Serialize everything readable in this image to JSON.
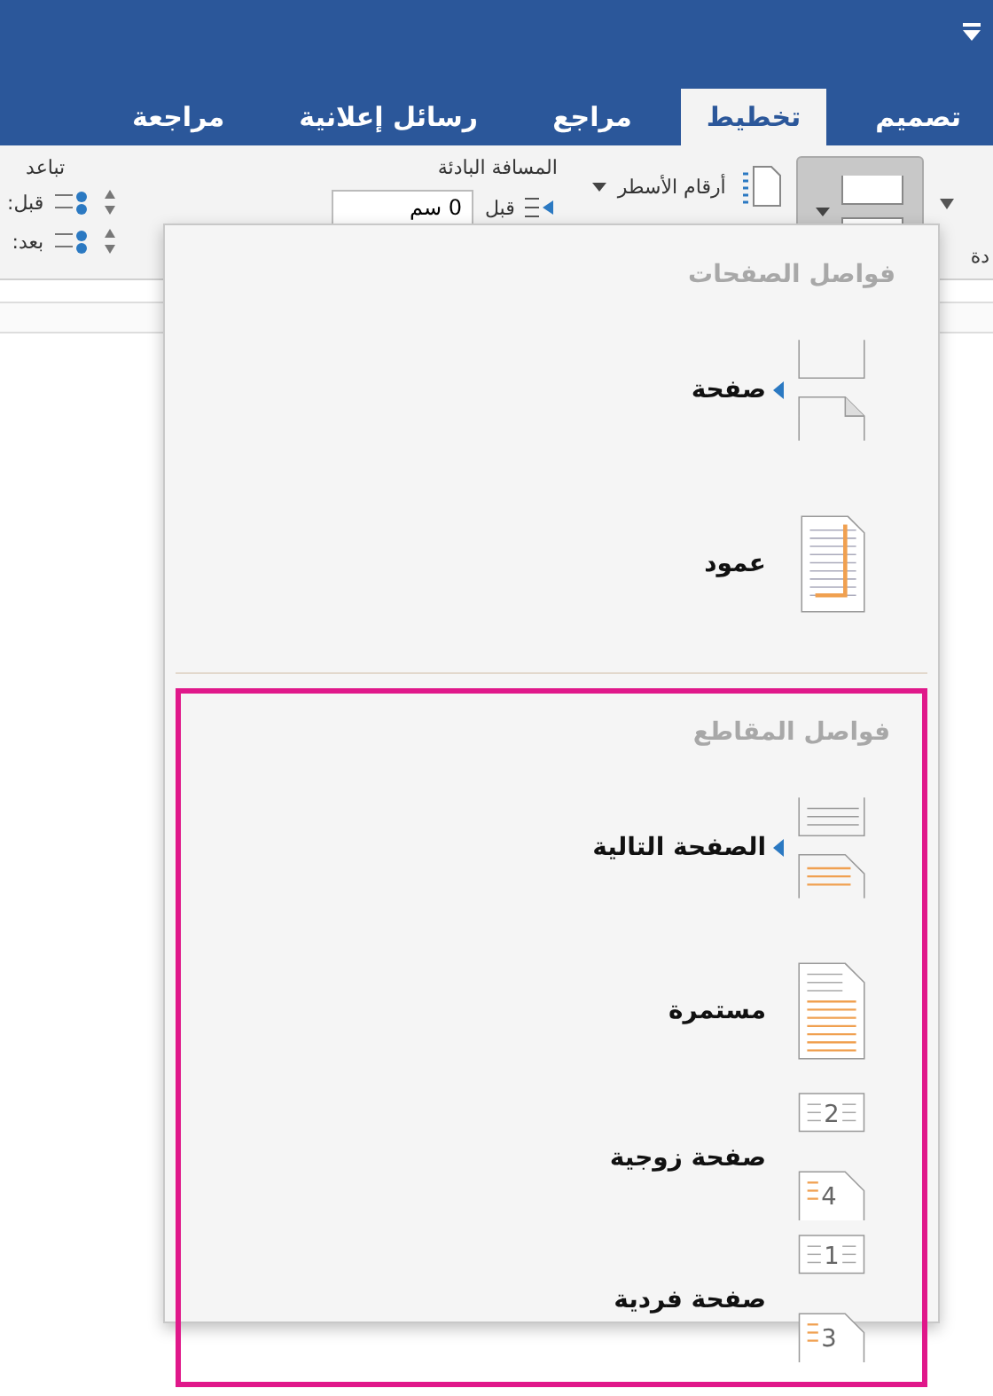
{
  "tabs": [
    {
      "label": "تصميم",
      "selected": false
    },
    {
      "label": "تخطيط",
      "selected": true
    },
    {
      "label": "مراجع",
      "selected": false
    },
    {
      "label": "رسائل إعلانية",
      "selected": false
    },
    {
      "label": "مراجعة",
      "selected": false
    }
  ],
  "ribbon": {
    "cut_group_label": "دة",
    "line_numbers": "أرقام الأسطر",
    "indent": {
      "title": "المسافة البادئة",
      "before_label": "قبل",
      "before_value": "0 سم"
    },
    "spacing": {
      "title": "تباعد",
      "before_label": "قبل:",
      "after_label": "بعد:"
    }
  },
  "menu": {
    "sections": [
      {
        "title": "فواصل الصفحات",
        "highlighted": false,
        "items": [
          {
            "label": "صفحة",
            "kind": "page",
            "submenu": true
          },
          {
            "label": "عمود",
            "kind": "column",
            "submenu": false
          }
        ]
      },
      {
        "title": "فواصل المقاطع",
        "highlighted": true,
        "items": [
          {
            "label": "الصفحة التالية",
            "kind": "next",
            "submenu": true
          },
          {
            "label": "مستمرة",
            "kind": "continuous",
            "submenu": false
          },
          {
            "label": "صفحة زوجية",
            "kind": "pair",
            "numbers": [
              "2",
              "4"
            ],
            "submenu": false
          },
          {
            "label": "صفحة فردية",
            "kind": "pair",
            "numbers": [
              "1",
              "3"
            ],
            "submenu": false
          }
        ]
      }
    ]
  }
}
